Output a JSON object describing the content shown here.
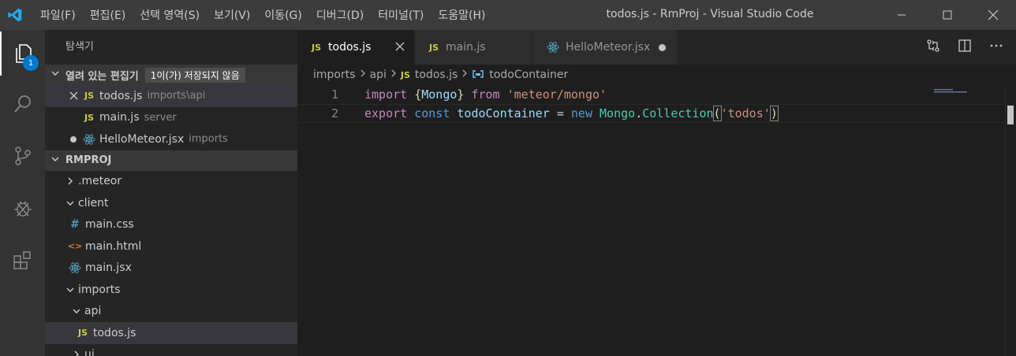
{
  "titlebar": {
    "menu": [
      "파일(F)",
      "편집(E)",
      "선택 영역(S)",
      "보기(V)",
      "이동(G)",
      "디버그(D)",
      "터미널(T)",
      "도움말(H)"
    ],
    "window_title": "todos.js - RmProj - Visual Studio Code"
  },
  "activity": {
    "explorer_badge": "1"
  },
  "sidebar": {
    "title": "탐색기",
    "open_editors": {
      "header": "열려 있는 편집기",
      "badge": "1이(가) 저장되지 않음",
      "items": [
        {
          "name": "todos.js",
          "desc": "imports\\api",
          "icon": "JS"
        },
        {
          "name": "main.js",
          "desc": "server",
          "icon": "JS"
        },
        {
          "name": "HelloMeteor.jsx",
          "desc": "imports",
          "icon": "react-icon"
        }
      ]
    },
    "project": {
      "header": "RMPROJ",
      "tree": [
        {
          "label": ".meteor"
        },
        {
          "label": "client"
        },
        {
          "label": "main.css",
          "icon": "#"
        },
        {
          "label": "main.html",
          "icon": "<>"
        },
        {
          "label": "main.jsx",
          "icon": "react-icon"
        },
        {
          "label": "imports"
        },
        {
          "label": "api"
        },
        {
          "label": "todos.js",
          "icon": "JS"
        },
        {
          "label": "ui"
        }
      ]
    }
  },
  "editor": {
    "tabs": [
      {
        "label": "todos.js",
        "icon": "JS"
      },
      {
        "label": "main.js",
        "icon": "JS"
      },
      {
        "label": "HelloMeteor.jsx",
        "icon": "react-icon"
      }
    ],
    "breadcrumb": [
      "imports",
      "api",
      "todos.js",
      "todoContainer"
    ],
    "lines": [
      {
        "num": "1",
        "tokens": [
          "import",
          " ",
          "{",
          "Mongo",
          "}",
          " ",
          "from",
          " ",
          "'meteor/mongo'"
        ]
      },
      {
        "num": "2",
        "tokens": [
          "export",
          " ",
          "const",
          " ",
          "todoContainer",
          " = ",
          "new",
          " ",
          "Mongo",
          ".",
          "Collection",
          "(",
          "'todos'",
          ")"
        ]
      }
    ]
  },
  "colors": {
    "accent": "#007acc",
    "keyword": "#c586c0",
    "string": "#ce9178",
    "class": "#4ec9b0",
    "variable": "#9cdcfe",
    "js_icon": "#cbcb41"
  }
}
